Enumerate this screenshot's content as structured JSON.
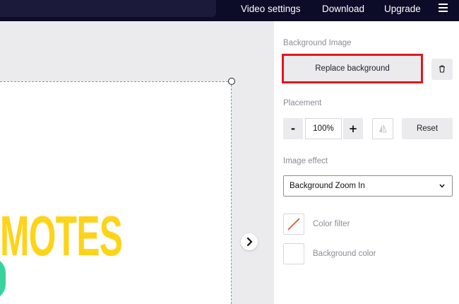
{
  "topbar": {
    "nav": [
      {
        "label": "Video settings"
      },
      {
        "label": "Download"
      },
      {
        "label": "Upgrade"
      }
    ],
    "menu_icon": "hamburger-menu-icon"
  },
  "canvas": {
    "visible_text": "MOTES",
    "text_color": "#ffd317",
    "accent_green": "#36d39a",
    "selection_color": "#2bbcb4"
  },
  "panel": {
    "background_image": {
      "label": "Background Image",
      "replace_button": "Replace background",
      "highlight_color": "#e0161d",
      "delete_icon": "trash-icon"
    },
    "placement": {
      "label": "Placement",
      "minus": "-",
      "zoom": "100%",
      "plus": "+",
      "flip_icon": "flip-horizontal-icon",
      "reset": "Reset"
    },
    "image_effect": {
      "label": "Image effect",
      "selected": "Background Zoom In"
    },
    "color_filter": {
      "label": "Color filter",
      "swatch": "no-color-slash"
    },
    "background_color": {
      "label": "Background color",
      "swatch": "#ffffff"
    }
  }
}
